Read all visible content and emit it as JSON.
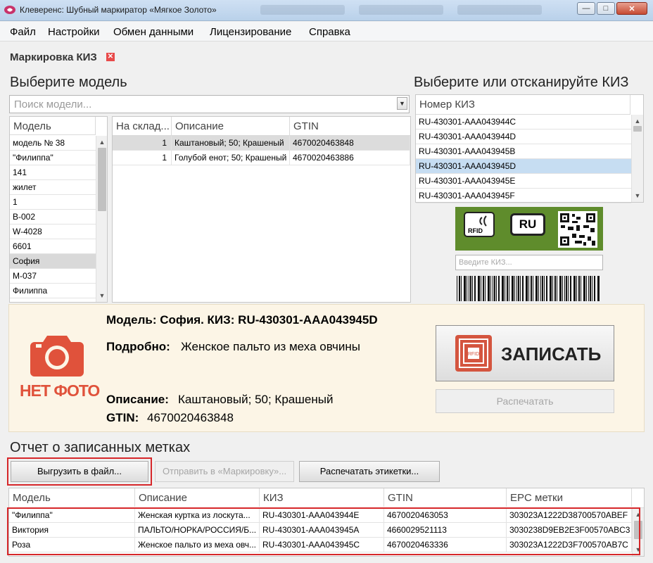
{
  "window": {
    "title": "Клеверенс: Шубный маркиратор «Мягкое Золото»",
    "minimize": "—",
    "maximize": "□",
    "close": "✕"
  },
  "menu": [
    "Файл",
    "Настройки",
    "Обмен данными",
    "Лицензирование",
    "Справка"
  ],
  "tab": {
    "title": "Маркировка КИЗ",
    "close": "✕"
  },
  "models": {
    "heading": "Выберите модель",
    "search_placeholder": "Поиск модели...",
    "list_header": "Модель",
    "items": [
      "модель № 38",
      "\"Филиппа\"",
      "141",
      "жилет",
      "1",
      "B-002",
      "W-4028",
      "6601",
      "София",
      "M-037",
      "Филиппа"
    ],
    "selected_index": 8
  },
  "stock": {
    "headers": [
      "На склад...",
      "Описание",
      "GTIN"
    ],
    "rows": [
      [
        "1",
        "Каштановый; 50; Крашеный",
        "4670020463848"
      ],
      [
        "1",
        "Голубой енот; 50; Крашеный",
        "4670020463886"
      ]
    ]
  },
  "kiz": {
    "heading": "Выберите или отсканируйте КИЗ",
    "list_header": "Номер КИЗ",
    "items": [
      "RU-430301-AAA043944C",
      "RU-430301-AAA043944D",
      "RU-430301-AAA043945B",
      "RU-430301-AAA043945D",
      "RU-430301-AAA043945E",
      "RU-430301-AAA043945F"
    ],
    "selected_index": 3,
    "label_badges": [
      "RFID",
      "RU"
    ],
    "input_placeholder": "Введите КИЗ..."
  },
  "details": {
    "no_photo": "НЕТ ФОТО",
    "title": "Модель: София. КИЗ: RU-430301-AAA043945D",
    "detail_label": "Подробно:",
    "detail_value": "Женское пальто из меха овчины",
    "desc_label": "Описание:",
    "desc_value": "Каштановый; 50; Крашеный",
    "gtin_label": "GTIN:",
    "gtin_value": "4670020463848",
    "write_button": "ЗАПИСАТЬ",
    "chip_text": "RFID",
    "print_button": "Распечатать"
  },
  "report": {
    "heading": "Отчет о записанных метках",
    "buttons": [
      "Выгрузить в файл...",
      "Отправить в «Маркировку»...",
      "Распечатать этикетки..."
    ],
    "headers": [
      "Модель",
      "Описание",
      "КИЗ",
      "GTIN",
      "EPC метки"
    ],
    "rows": [
      [
        "\"Филиппа\"",
        "Женская куртка из лоскута...",
        "RU-430301-AAA043944E",
        "4670020463053",
        "303023A1222D38700570ABEF"
      ],
      [
        "Виктория",
        "ПАЛЬТО/НОРКА/РОССИЯ/Б...",
        "RU-430301-AAA043945A",
        "4660029521113",
        "3030238D9EB2E3F00570ABC3"
      ],
      [
        "Роза",
        "Женское пальто из меха овч...",
        "RU-430301-AAA043945C",
        "4670020463336",
        "303023A1222D3F700570AB7C"
      ]
    ]
  }
}
